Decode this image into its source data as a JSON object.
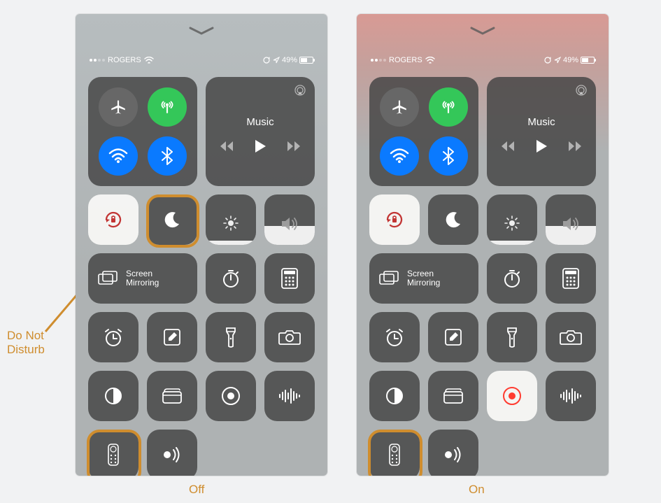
{
  "annotations": {
    "dnd_line1": "Do Not",
    "dnd_line2": "Disturb",
    "caption_off": "Off",
    "caption_on": "On"
  },
  "statusbar": {
    "carrier": "ROGERS",
    "battery_pct": "49%"
  },
  "music": {
    "title": "Music"
  },
  "mirror": {
    "line1": "Screen",
    "line2": "Mirroring"
  },
  "sliders": {
    "brightness_pct": 8,
    "volume_pct": 38
  }
}
